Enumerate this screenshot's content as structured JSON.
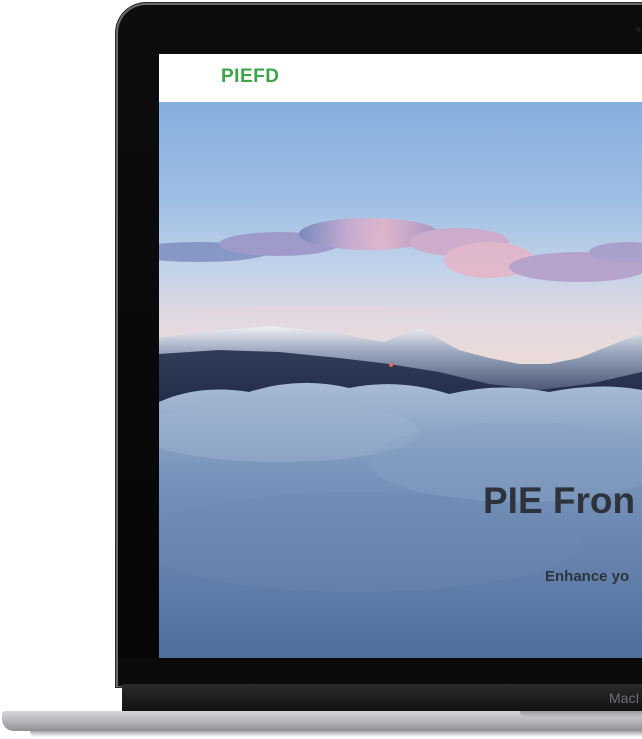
{
  "site": {
    "logo": "PIEFD"
  },
  "hero": {
    "title": "PIE Fron",
    "subtitle": "Enhance yo"
  },
  "device": {
    "brand_text": "MacI"
  },
  "colors": {
    "logo_green": "#3aa646",
    "hero_text": "#2e333b",
    "sky_top": "#86aedd",
    "clouds_low": "#4e6f9c"
  }
}
